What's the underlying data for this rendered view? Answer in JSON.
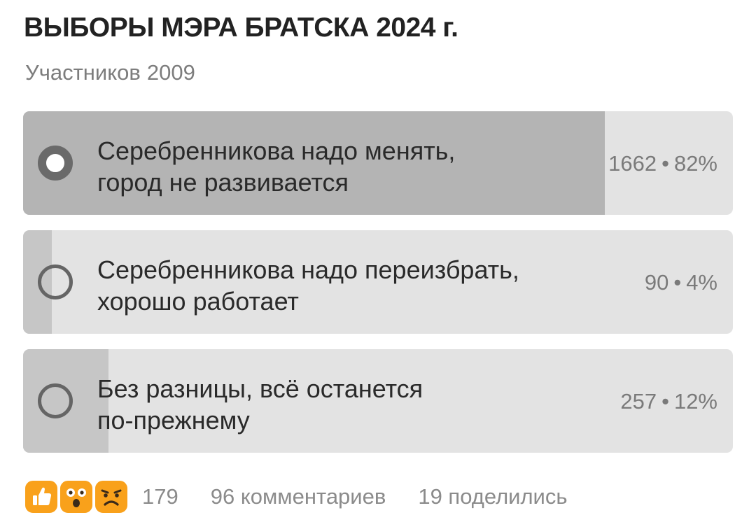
{
  "poll": {
    "title": "ВЫБОРЫ МЭРА БРАТСКА 2024 г.",
    "participants_label": "Участников",
    "participants_count": "2009",
    "options": [
      {
        "line1": "Серебренникова надо менять,",
        "line2": "город не развивается",
        "votes": "1662",
        "separator": "•",
        "percent_label": "82%",
        "percent": 82,
        "selected": true
      },
      {
        "line1": "Серебренникова надо переизбрать,",
        "line2": "хорошо работает",
        "votes": "90",
        "separator": "•",
        "percent_label": "4%",
        "percent": 4,
        "selected": false
      },
      {
        "line1": "Без разницы, всё останется",
        "line2": "по-прежнему",
        "votes": "257",
        "separator": "•",
        "percent_label": "12%",
        "percent": 12,
        "selected": false
      }
    ]
  },
  "footer": {
    "reactions": [
      {
        "icon": "thumbs-up-icon"
      },
      {
        "icon": "surprised-face-icon"
      },
      {
        "icon": "sad-face-icon"
      }
    ],
    "reaction_count": "179",
    "comments": "96 комментариев",
    "shares": "19 поделились"
  },
  "colors": {
    "option_background": "#e3e3e3",
    "bar_fill": "#c6c6c6",
    "bar_fill_selected": "#b4b4b4",
    "reaction_accent": "#f9a11b"
  }
}
